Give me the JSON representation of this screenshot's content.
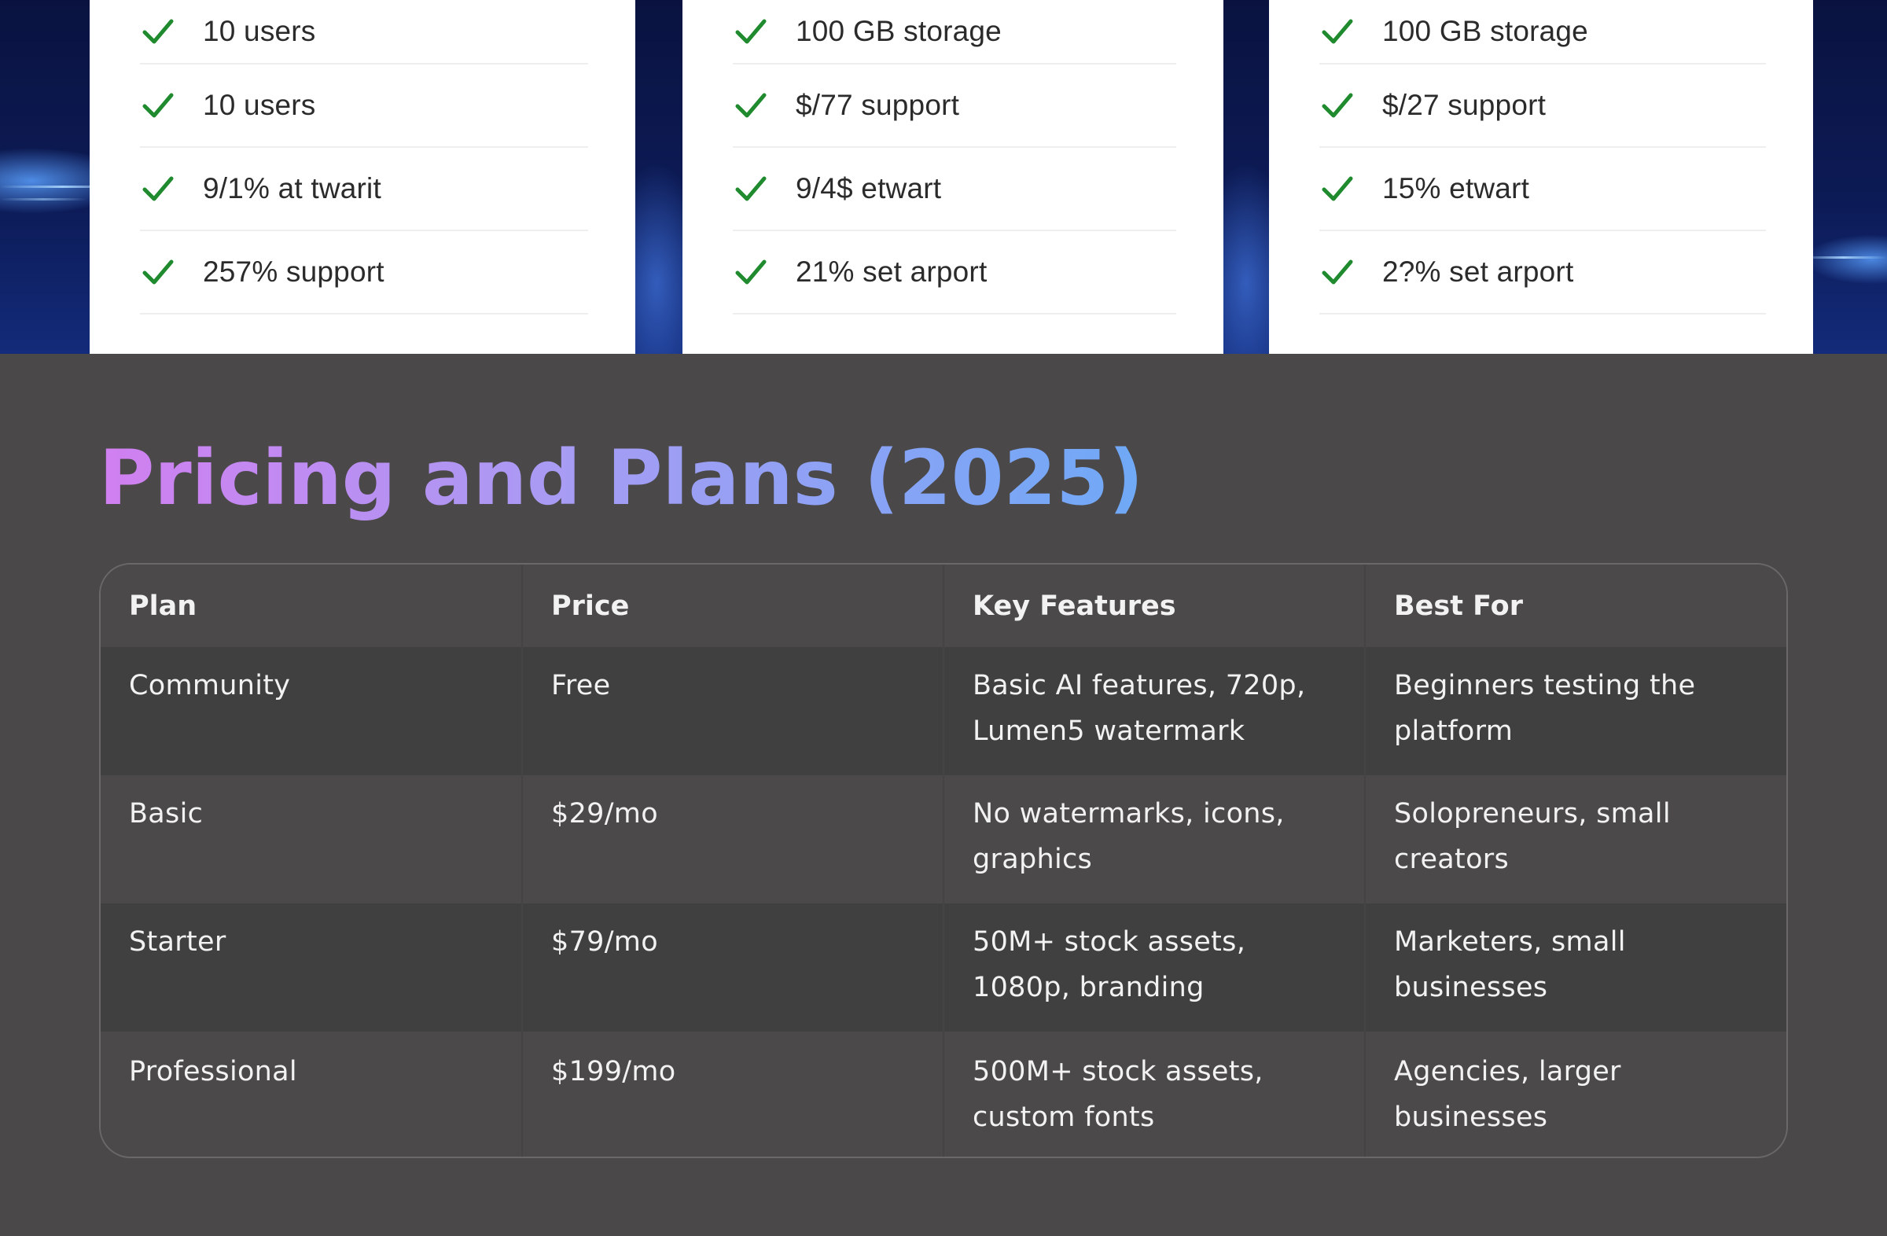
{
  "hero": {
    "cards": [
      {
        "items": [
          "10 users",
          "10 users",
          "9/1% at twarit",
          "257% support"
        ]
      },
      {
        "items": [
          "100 GB storage",
          "$/77 support",
          "9/4$ etwart",
          "21% set arport"
        ]
      },
      {
        "items": [
          "100 GB storage",
          "$/27 support",
          "15% etwart",
          "2?% set arport"
        ]
      }
    ],
    "check_icon": "check-icon",
    "check_color": "#1f8a2e"
  },
  "section": {
    "title": "Pricing and Plans (2025)",
    "title_gradient": [
      "#d17ff0",
      "#6fa9f6"
    ]
  },
  "table": {
    "headers": [
      "Plan",
      "Price",
      "Key Features",
      "Best For"
    ],
    "rows": [
      {
        "plan": "Community",
        "price": "Free",
        "features": "Basic AI features, 720p, Lumen5 watermark",
        "best_for": "Beginners testing the platform"
      },
      {
        "plan": "Basic",
        "price": "$29/mo",
        "features": "No watermarks, icons, graphics",
        "best_for": "Solopreneurs, small creators"
      },
      {
        "plan": "Starter",
        "price": "$79/mo",
        "features": "50M+ stock assets, 1080p, branding",
        "best_for": "Marketers, small businesses"
      },
      {
        "plan": "Professional",
        "price": "$199/mo",
        "features": "500M+ stock assets, custom fonts",
        "best_for": "Agencies, larger businesses"
      }
    ]
  },
  "colors": {
    "page_background": "#4a4849",
    "row_dark": "#414041",
    "row_light": "#4b494a"
  }
}
